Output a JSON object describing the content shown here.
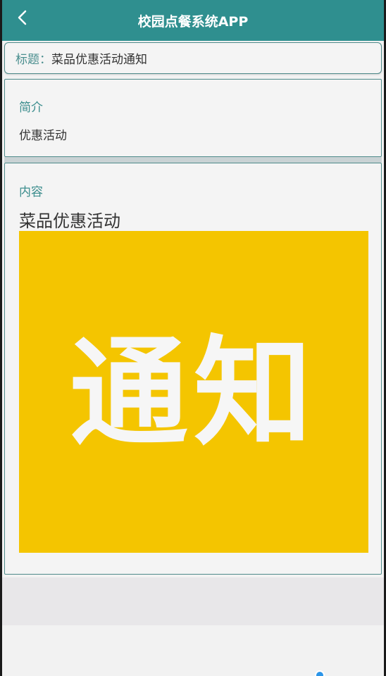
{
  "header": {
    "title": "校园点餐系统APP",
    "back_icon": "chevron-left-icon"
  },
  "title_card": {
    "label": "标题：",
    "value": "菜品优惠活动通知"
  },
  "summary": {
    "label": "简介",
    "text": "优惠活动"
  },
  "content": {
    "label": "内容",
    "headline": "菜品优惠活动",
    "banner_text": "通知"
  },
  "colors": {
    "header_bg": "#2f8f8f",
    "label_color": "#3b8d8d",
    "banner_bg": "#f4c500"
  }
}
